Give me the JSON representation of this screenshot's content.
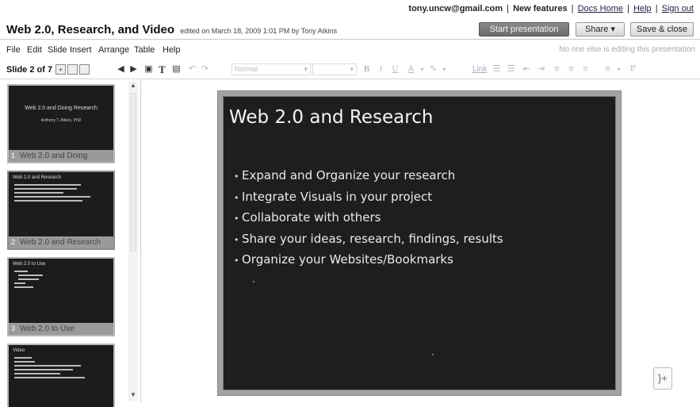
{
  "account": {
    "email": "tony.uncw@gmail.com",
    "sep": "|",
    "new_features": "New features",
    "docs_home": "Docs Home",
    "help": "Help",
    "sign_out": "Sign out"
  },
  "document": {
    "title": "Web 2.0, Research, and Video",
    "edited": "edited on March 18, 2009 1:01 PM by Tony Atkins"
  },
  "buttons": {
    "start_presentation": "Start presentation",
    "share": "Share ▾",
    "save_close": "Save & close"
  },
  "menu": {
    "items": [
      "File",
      "Edit",
      "Slide",
      "Insert",
      "Arrange",
      "Table",
      "Help"
    ],
    "status": "No one else is editing this presentation"
  },
  "toolbar": {
    "slide_count": "Slide 2 of 7",
    "style_select": "Normal",
    "link": "Link"
  },
  "slides": [
    {
      "index": "1",
      "caption": "Web 2.0 and Doing",
      "thumb_title": "Web 2.0 and Doing Research",
      "thumb_sub": "Anthony T. Atkins, PhD"
    },
    {
      "index": "2",
      "caption": "Web 2.0 and Research",
      "thumb_title": "Web 2.0 and Research"
    },
    {
      "index": "3",
      "caption": "Web 2.0 to Use",
      "thumb_title": "Web 2.0 to Use"
    },
    {
      "index": "4",
      "caption": "",
      "thumb_title": "Video"
    }
  ],
  "current_slide": {
    "title": "Web 2.0 and Research",
    "bullets": [
      "Expand and Organize your research",
      "Integrate Visuals in your project",
      "Collaborate with others",
      "Share your ideas, research, findings, results",
      "Organize your Websites/Bookmarks"
    ]
  },
  "icons": {
    "speaker_notes": "speaker-notes-icon"
  }
}
